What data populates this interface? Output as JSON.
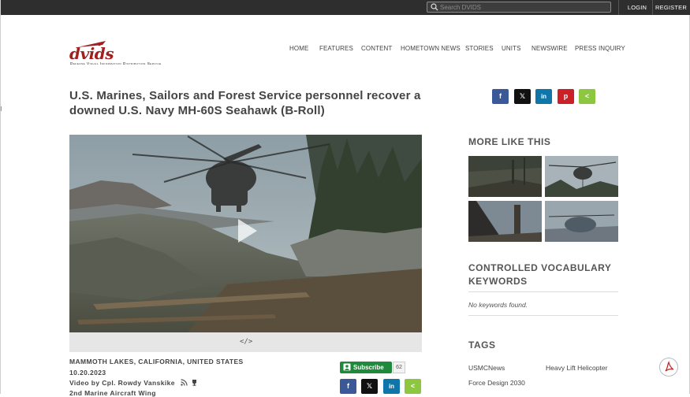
{
  "topbar": {
    "search_placeholder": "Search DVIDS",
    "login": "LOGIN",
    "register": "REGISTER"
  },
  "logo": {
    "wordmark": "dvids",
    "tagline": "Defense Visual Information Distribution Service"
  },
  "nav": [
    "HOME",
    "FEATURES",
    "CONTENT",
    "HOMETOWN NEWS",
    "STORIES",
    "UNITS",
    "NEWSWIRE",
    "PRESS INQUIRY"
  ],
  "title": "U.S. Marines, Sailors and Forest Service personnel recover a downed U.S. Navy MH-60S Seahawk (B-Roll)",
  "share": {
    "facebook": "f",
    "x": "𝕏",
    "linkedin": "in",
    "pinterest": "p",
    "share": "<"
  },
  "video": {
    "embed_label": "</>"
  },
  "meta": {
    "location": "MAMMOTH LAKES, CALIFORNIA, UNITED STATES",
    "date": "10.20.2023",
    "byline": "Video by Cpl. Rowdy Vanskike",
    "unit": "2nd Marine Aircraft Wing"
  },
  "subscribe": {
    "label": "Subscribe",
    "count": "62"
  },
  "sidebar": {
    "more_like_this": "MORE LIKE THIS",
    "vocab_heading": "CONTROLLED VOCABULARY KEYWORDS",
    "no_keywords": "No keywords found.",
    "tags_heading": "TAGS",
    "tags": [
      "USMCNews",
      "Heavy Lift Helicopter",
      "Force Design 2030"
    ]
  },
  "colors": {
    "topbar": "#2e2e2e",
    "brand_red": "#a01f1f",
    "subscribe_green": "#1f8a3a",
    "facebook": "#3b5998",
    "linkedin": "#0e76a8",
    "pinterest": "#cb2027",
    "share_green": "#8dc63f"
  },
  "icons": [
    "search-icon",
    "play-icon",
    "embed-icon",
    "rss-icon",
    "trophy-icon",
    "pdf-icon",
    "user-icon"
  ]
}
